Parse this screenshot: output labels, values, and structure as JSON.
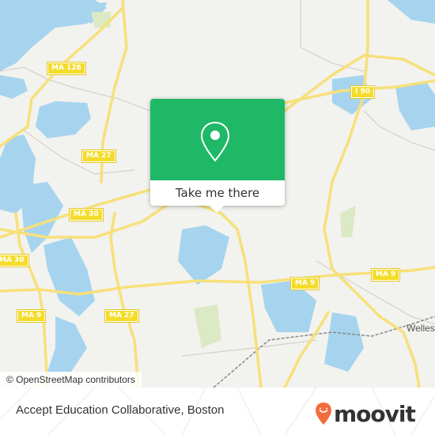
{
  "map": {
    "road_shields": [
      {
        "label": "MA 126"
      },
      {
        "label": "MA 27"
      },
      {
        "label": "MA 30"
      },
      {
        "label": "MA 30"
      },
      {
        "label": "MA 9"
      },
      {
        "label": "MA 27"
      },
      {
        "label": "I 90"
      },
      {
        "label": "MA 9"
      },
      {
        "label": "MA 9"
      }
    ],
    "place_labels": [
      {
        "label": "Welles"
      }
    ],
    "attribution": "© OpenStreetMap contributors",
    "colors": {
      "land": "#f2f2ee",
      "water": "#a6d4ee",
      "road": "#f7e07a",
      "park": "#dbe9c4"
    }
  },
  "popup": {
    "icon": "map-pin-icon",
    "action_label": "Take me there",
    "color": "#1fb866"
  },
  "footer": {
    "title": "Accept Education Collaborative, Boston",
    "brand": "moovit",
    "brand_color": "#f26b3a"
  }
}
